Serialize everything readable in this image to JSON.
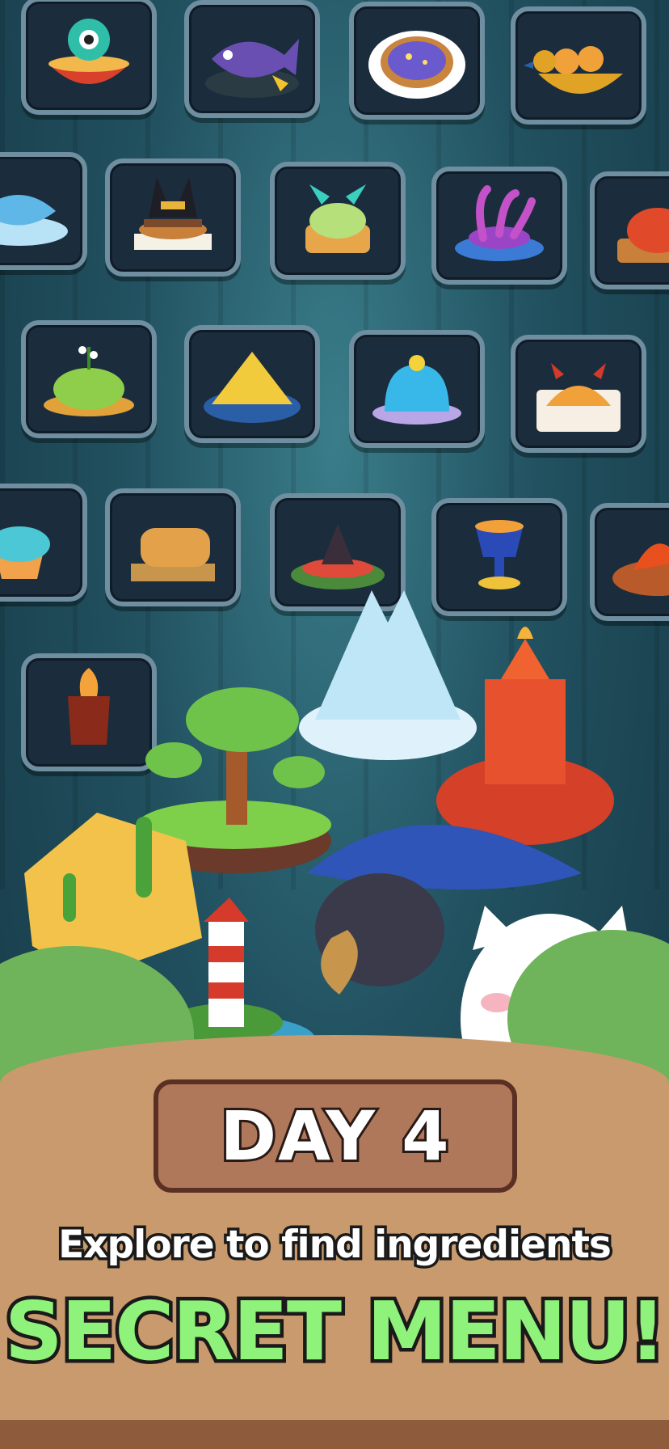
{
  "banner": {
    "day_label": "DAY 4",
    "subtitle": "Explore to find ingredients",
    "headline": "SECRET MENU!"
  },
  "menu_items": [
    {
      "icon": "eyeball-noodle-bowl-icon"
    },
    {
      "icon": "piranha-fish-plate-icon"
    },
    {
      "icon": "galaxy-cookie-icon"
    },
    {
      "icon": "golden-bird-dumplings-icon"
    },
    {
      "icon": "ice-fish-icon"
    },
    {
      "icon": "anubis-burger-icon"
    },
    {
      "icon": "green-bun-icon"
    },
    {
      "icon": "tentacle-pasta-icon"
    },
    {
      "icon": "red-steamed-bun-icon"
    },
    {
      "icon": "lily-rice-icon"
    },
    {
      "icon": "pyramid-rice-icon"
    },
    {
      "icon": "jelly-pudding-icon"
    },
    {
      "icon": "devil-pie-icon"
    },
    {
      "icon": "mermaid-cupcake-icon"
    },
    {
      "icon": "cat-bread-icon"
    },
    {
      "icon": "carousel-salad-icon"
    },
    {
      "icon": "eye-goblet-soup-icon"
    },
    {
      "icon": "lava-dish-icon"
    },
    {
      "icon": "flaming-cocoa-icon"
    }
  ],
  "colors": {
    "headline_green": "#8ff27a",
    "sign_brown": "#b0785b",
    "tile_border": "#6f8ea0"
  }
}
